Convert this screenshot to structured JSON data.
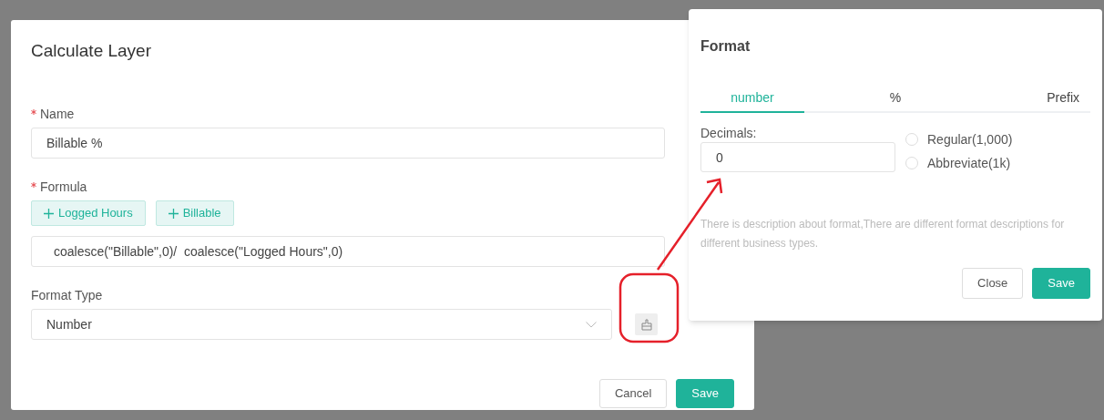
{
  "dialog": {
    "title": "Calculate Layer",
    "name_field": {
      "label": "Name",
      "required": true,
      "value": "Billable %"
    },
    "formula": {
      "label": "Formula",
      "required": true,
      "chips": [
        {
          "label": "Logged Hours"
        },
        {
          "label": "Billable"
        }
      ],
      "value": "coalesce(\"Billable\",0)/  coalesce(\"Logged Hours\",0)"
    },
    "format_type": {
      "label": "Format Type",
      "value": "Number"
    },
    "buttons": [
      {
        "label": "Cancel",
        "kind": "secondary"
      },
      {
        "label": "Save",
        "kind": "primary"
      }
    ]
  },
  "format_popover": {
    "title": "Format",
    "tabs": [
      {
        "label": "number",
        "selected": true
      },
      {
        "label": "%",
        "selected": false
      },
      {
        "label": "Prefix",
        "selected": false
      }
    ],
    "decimals": {
      "label": "Decimals:",
      "value": "0"
    },
    "radios": [
      {
        "label": "Regular(1,000)",
        "selected": false
      },
      {
        "label": "Abbreviate(1k)",
        "selected": false
      }
    ],
    "description": "There is description about format,There are different format descriptions for different business types.",
    "buttons": [
      {
        "label": "Close",
        "kind": "secondary"
      },
      {
        "label": "Save",
        "kind": "primary"
      }
    ]
  }
}
